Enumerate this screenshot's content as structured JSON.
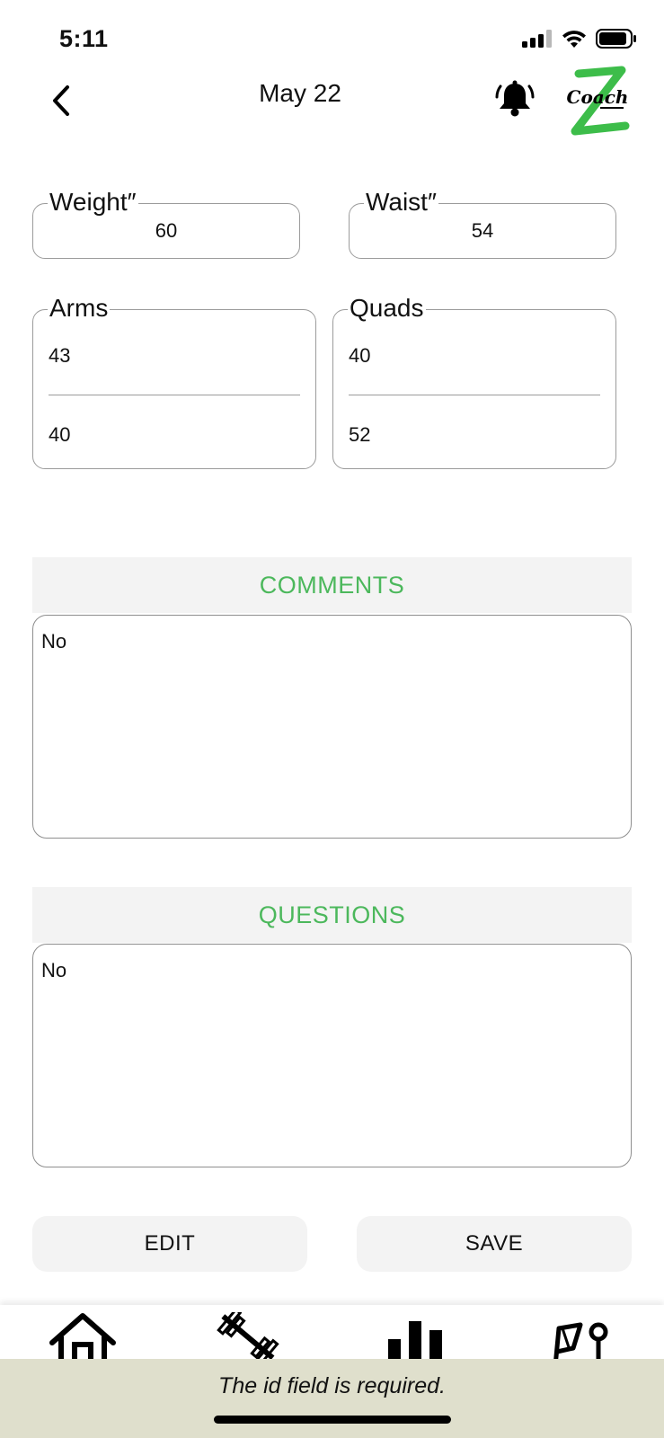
{
  "status_bar": {
    "time": "5:11"
  },
  "header": {
    "title": "May 22",
    "logo_text": "Coach Z"
  },
  "measurements": {
    "weight": {
      "label": "Weight″",
      "value": "60"
    },
    "waist": {
      "label": "Waist″",
      "value": "54"
    },
    "arms": {
      "label": "Arms",
      "top": "43",
      "bottom": "40"
    },
    "quads": {
      "label": "Quads",
      "top": "40",
      "bottom": "52"
    }
  },
  "comments": {
    "title": "COMMENTS",
    "text": "No"
  },
  "questions": {
    "title": "QUESTIONS",
    "text": "No"
  },
  "actions": {
    "edit_label": "EDIT",
    "save_label": "SAVE"
  },
  "tabs": [
    {
      "icon": "home-icon"
    },
    {
      "icon": "dumbbell-icon"
    },
    {
      "icon": "bar-chart-icon"
    },
    {
      "icon": "goal-flag-icon"
    }
  ],
  "toast": {
    "message": "The id field is required."
  },
  "colors": {
    "accent": "#4cb85c",
    "section_bg": "#f3f3f3",
    "toast_bg": "#dfdfcc"
  }
}
